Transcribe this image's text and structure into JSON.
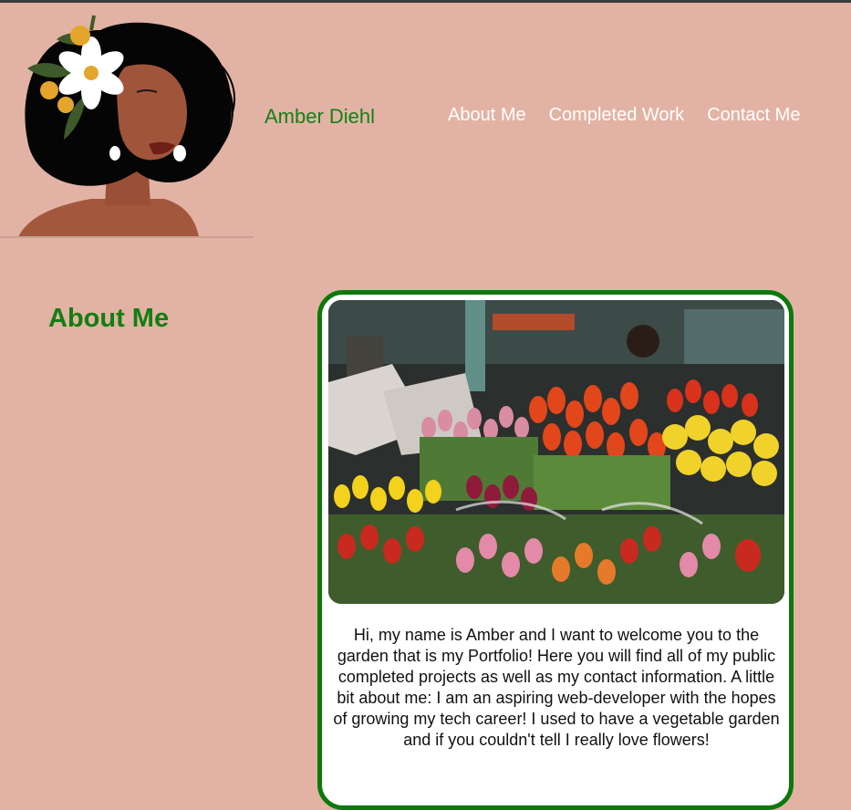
{
  "site": {
    "name": "Amber Diehl"
  },
  "nav": {
    "items": [
      {
        "label": "About Me"
      },
      {
        "label": "Completed Work"
      },
      {
        "label": "Contact Me"
      }
    ]
  },
  "about": {
    "title": "About Me",
    "bio": "Hi, my name is Amber and I want to welcome you to the garden that is my Portfolio! Here you will find all of my public completed projects as well as my contact information. A little bit about me: I am an aspiring web-developer with the hopes of growing my tech career! I used to have a vegetable garden and if you couldn't tell I really love flowers!"
  },
  "colors": {
    "background": "#e2b3a4",
    "accent_green": "#0b7a0b",
    "nav_text": "#ffffff"
  }
}
